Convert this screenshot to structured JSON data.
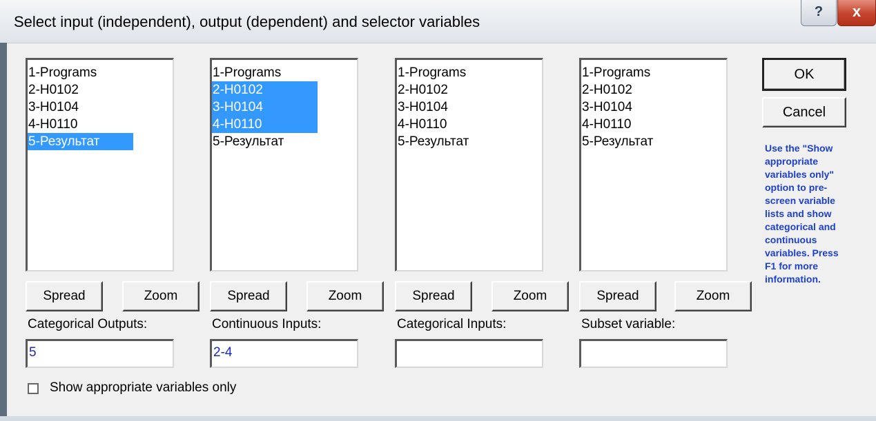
{
  "window": {
    "title": "Select input (independent), output (dependent) and selector variables",
    "help_label": "?",
    "close_label": "x"
  },
  "columns": [
    {
      "items": [
        {
          "label": "1-Programs",
          "selected": false
        },
        {
          "label": "2-H0102",
          "selected": false
        },
        {
          "label": "3-H0104",
          "selected": false
        },
        {
          "label": "4-H0110",
          "selected": false
        },
        {
          "label": "5-Результат",
          "selected": true
        }
      ],
      "spread_label": "Spread",
      "zoom_label": "Zoom",
      "field_label": "Categorical Outputs:",
      "field_value": "5"
    },
    {
      "items": [
        {
          "label": "1-Programs",
          "selected": false
        },
        {
          "label": "2-H0102",
          "selected": true
        },
        {
          "label": "3-H0104",
          "selected": true
        },
        {
          "label": "4-H0110",
          "selected": true
        },
        {
          "label": "5-Результат",
          "selected": false
        }
      ],
      "spread_label": "Spread",
      "zoom_label": "Zoom",
      "field_label": "Continuous Inputs:",
      "field_value": "2-4"
    },
    {
      "items": [
        {
          "label": "1-Programs",
          "selected": false
        },
        {
          "label": "2-H0102",
          "selected": false
        },
        {
          "label": "3-H0104",
          "selected": false
        },
        {
          "label": "4-H0110",
          "selected": false
        },
        {
          "label": "5-Результат",
          "selected": false
        }
      ],
      "spread_label": "Spread",
      "zoom_label": "Zoom",
      "field_label": "Categorical Inputs:",
      "field_value": ""
    },
    {
      "items": [
        {
          "label": "1-Programs",
          "selected": false
        },
        {
          "label": "2-H0102",
          "selected": false
        },
        {
          "label": "3-H0104",
          "selected": false
        },
        {
          "label": "4-H0110",
          "selected": false
        },
        {
          "label": "5-Результат",
          "selected": false
        }
      ],
      "spread_label": "Spread",
      "zoom_label": "Zoom",
      "field_label": "Subset variable:",
      "field_value": ""
    }
  ],
  "ok_label": "OK",
  "cancel_label": "Cancel",
  "hint": "Use the \"Show appropriate variables only\" option to pre-screen variable lists and show categorical and continuous variables. Press F1 for more information.",
  "show_appropriate_label": "Show appropriate variables only",
  "show_appropriate_checked": false,
  "colors": {
    "selection": "#3399ff",
    "hint_text": "#1d3fd0",
    "field_text": "#1a2bb0"
  }
}
